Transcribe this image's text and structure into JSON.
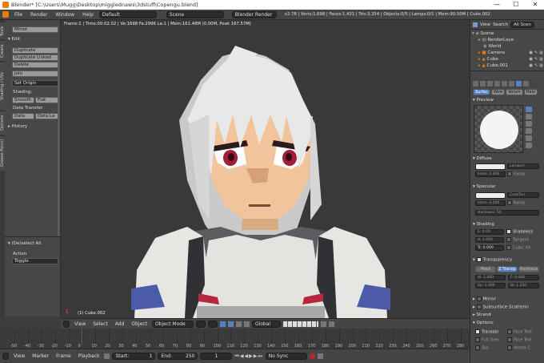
{
  "window": {
    "title": "Blender* [C:\\Users\\Mugg\\Desktop\\migglednaws\\3dstuff\\Copengu.blend]",
    "minimize_glyph": "—",
    "maximize_glyph": "☐",
    "close_glyph": "✕"
  },
  "infobar": {
    "menus": [
      "File",
      "Render",
      "Window",
      "Help"
    ],
    "layout": "Default",
    "scene": "Scene",
    "engine": "Blender Render",
    "stats": "v2.78 | Verts:1,698 | Faces:1,431 | Tris:3,354 | Objects:0/5 | Lamps:0/1 | Mem:90.50M | Cube.002"
  },
  "toolstrip_tabs": [
    "Tools",
    "Create",
    "Shading / UVs",
    "Options",
    "Grease Pencil"
  ],
  "tools_panel": {
    "mirror": "Mirror",
    "edit_header": "Edit",
    "duplicate": "Duplicate",
    "duplicate_linked": "Duplicate Linked",
    "delete": "Delete",
    "join": "Join",
    "set_origin": "Set Origin",
    "shading_label": "Shading:",
    "smooth": "Smooth",
    "flat": "Flat",
    "data_transfer_label": "Data Transfer:",
    "data": "Data",
    "data_la": "Data La",
    "history": "History",
    "deselect_all": "(De)select All",
    "action_label": "Action",
    "action_value": "Toggle"
  },
  "viewport": {
    "overlay_stats": "Frame:1 | Time:00:02.02 | Ve:1698 Fa:2996 La:1 | Mem:161.48M (0.00M, Peak 167.57M)",
    "object_label": "(1) Cube.002"
  },
  "viewport_header": {
    "menus": [
      "View",
      "Select",
      "Add",
      "Object"
    ],
    "mode": "Object Mode",
    "transform_orientation": "Global"
  },
  "timeline": {
    "ticks": [
      "-50",
      "-40",
      "-30",
      "-20",
      "-10",
      "0",
      "10",
      "20",
      "30",
      "40",
      "50",
      "60",
      "70",
      "80",
      "90",
      "100",
      "110",
      "120",
      "130",
      "140",
      "150",
      "160",
      "170",
      "180",
      "190",
      "200",
      "210",
      "220",
      "230",
      "240",
      "250",
      "260",
      "270",
      "280"
    ],
    "menus": [
      "View",
      "Marker",
      "Frame",
      "Playback"
    ],
    "start_label": "Start:",
    "start_value": "1",
    "end_label": "End:",
    "end_value": "250",
    "current_frame": "1",
    "sync": "No Sync"
  },
  "outliner": {
    "header_tabs": [
      "View",
      "Search",
      "All Scen"
    ],
    "items": [
      "Scene",
      "RenderLaye",
      "World",
      "Camera",
      "Cube",
      "Cube.001"
    ]
  },
  "properties": {
    "tabs": [
      "Surfac",
      "Wire",
      "Volum",
      "Halo"
    ],
    "preview": "Preview",
    "diffuse": "Diffuse",
    "diffuse_shader": "Lambert",
    "diffuse_intensity": "Inten: 0.800",
    "ramp": "Ramp",
    "specular": "Specular",
    "specular_shader": "CookTorr",
    "specular_intensity": "Inten: 0.500",
    "hardness": "Hardness: 50",
    "shading": "Shading",
    "emit": "E: 0.00",
    "ambient": "A: 1.000",
    "translucency": "Tr: 0.000",
    "shadeless": "Shadeless",
    "tangent": "Tangent",
    "cubic": "Cubic Int",
    "transparency": "Transparency",
    "mask": "Mask",
    "ztransp": "Z Transp",
    "raytrace": "Raytrace",
    "alpha": "Al: 1.000",
    "fresnel": "F: 0.000",
    "spec_t": "Sp: 1.000",
    "blend": "Bl: 1.250",
    "mirror": "Mirror",
    "sss": "Subsurface Scatterin",
    "strand": "Strand",
    "options": "Options",
    "traceable": "Traceabl",
    "face_text": "Face Text",
    "full_over": "Full Over",
    "face_text2": "Face Text",
    "sky": "Sky",
    "vertex_c": "Vertex C"
  },
  "colors": {
    "accent": "#e87d0d",
    "selected_blue": "#5680c2",
    "playhead": "#3c7b3c"
  }
}
